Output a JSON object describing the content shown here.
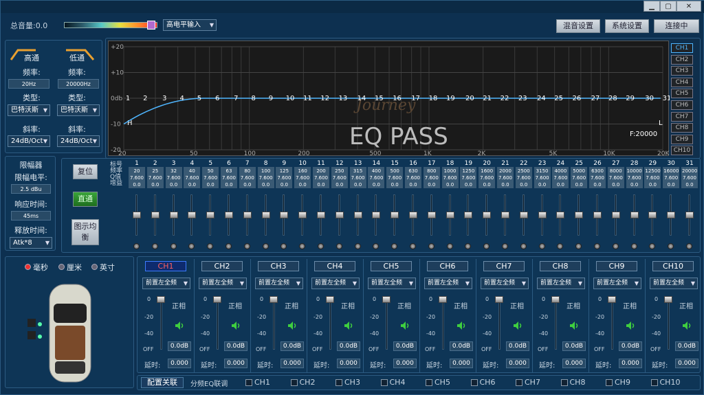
{
  "window": {
    "min": "▁",
    "max": "▢",
    "close": "✕"
  },
  "top": {
    "total_volume_label": "总音量:0.0",
    "input_select": "高电平输入",
    "mix_btn": "混音设置",
    "sys_btn": "系统设置",
    "connect_btn": "连接中"
  },
  "xover": {
    "hp_title": "高通",
    "lp_title": "低通",
    "freq_label": "频率:",
    "hp_freq": "20Hz",
    "lp_freq": "20000Hz",
    "type_label": "类型:",
    "hp_type": "巴特沃斯",
    "lp_type": "巴特沃斯",
    "slope_label": "斜率:",
    "hp_slope": "24dB/Oct",
    "lp_slope": "24dB/Oct"
  },
  "limiter": {
    "title": "限幅器",
    "level_label": "限幅电平:",
    "level": "2.5 dBu",
    "attack_label": "响应时间:",
    "attack": "45ms",
    "release_label": "释放时间:",
    "release": "Atk*8"
  },
  "graph": {
    "y_ticks": [
      "+20",
      "+10",
      "0db",
      "-10",
      "-20"
    ],
    "x_ticks": [
      "20",
      "50",
      "100",
      "200",
      "500",
      "1K",
      "2K",
      "5K",
      "10K",
      "20K"
    ],
    "hp_marker": "H",
    "lp_marker": "L",
    "mode_text": "EQ PASS",
    "freq_readout": "F:20000",
    "logo_text": "Journey",
    "band_numbers": [
      "1",
      "2",
      "3",
      "4",
      "5",
      "6",
      "7",
      "8",
      "9",
      "10",
      "11",
      "12",
      "13",
      "14",
      "15",
      "16",
      "17",
      "18",
      "19",
      "20",
      "21",
      "22",
      "23",
      "24",
      "25",
      "26",
      "27",
      "28",
      "29",
      "30",
      "31"
    ]
  },
  "channels_side": [
    "CH1",
    "CH2",
    "CH3",
    "CH4",
    "CH5",
    "CH6",
    "CH7",
    "CH8",
    "CH9",
    "CH10"
  ],
  "eq": {
    "row_labels": [
      "标号",
      "频率",
      "Q值",
      "增益"
    ],
    "reset_btn": "复位",
    "bypass_btn": "直通",
    "graph_eq_btn": "图示均衡",
    "freqs": [
      "20",
      "25",
      "32",
      "40",
      "50",
      "63",
      "80",
      "100",
      "125",
      "160",
      "200",
      "250",
      "315",
      "400",
      "500",
      "630",
      "800",
      "1000",
      "1250",
      "1600",
      "2000",
      "2500",
      "3150",
      "4000",
      "5000",
      "6300",
      "8000",
      "10000",
      "12500",
      "16000",
      "20000"
    ],
    "q": "7.600",
    "gain": "0.0"
  },
  "units": {
    "ms": "毫秒",
    "cm": "厘米",
    "inch": "英寸"
  },
  "outputs": [
    {
      "name": "CH1",
      "route": "前置左全频",
      "phase": "正相",
      "gain": "0.0dB",
      "delay_label": "延时:",
      "delay": "0.000"
    },
    {
      "name": "CH2",
      "route": "前置左全频",
      "phase": "正相",
      "gain": "0.0dB",
      "delay_label": "延时:",
      "delay": "0.000"
    },
    {
      "name": "CH3",
      "route": "前置左全频",
      "phase": "正相",
      "gain": "0.0dB",
      "delay_label": "延时:",
      "delay": "0.000"
    },
    {
      "name": "CH4",
      "route": "前置左全频",
      "phase": "正相",
      "gain": "0.0dB",
      "delay_label": "延时:",
      "delay": "0.000"
    },
    {
      "name": "CH5",
      "route": "前置左全频",
      "phase": "正相",
      "gain": "0.0dB",
      "delay_label": "延时:",
      "delay": "0.000"
    },
    {
      "name": "CH6",
      "route": "前置左全频",
      "phase": "正相",
      "gain": "0.0dB",
      "delay_label": "延时:",
      "delay": "0.000"
    },
    {
      "name": "CH7",
      "route": "前置左全频",
      "phase": "正相",
      "gain": "0.0dB",
      "delay_label": "延时:",
      "delay": "0.000"
    },
    {
      "name": "CH8",
      "route": "前置左全频",
      "phase": "正相",
      "gain": "0.0dB",
      "delay_label": "延时:",
      "delay": "0.000"
    },
    {
      "name": "CH9",
      "route": "前置左全频",
      "phase": "正相",
      "gain": "0.0dB",
      "delay_label": "延时:",
      "delay": "0.000"
    },
    {
      "name": "CH10",
      "route": "前置左全频",
      "phase": "正相",
      "gain": "0.0dB",
      "delay_label": "延时:",
      "delay": "0.000"
    }
  ],
  "fader_scale": [
    "0",
    "-20",
    "-40",
    "OFF"
  ],
  "bottom": {
    "config_btn": "配置关联",
    "link_label": "分频EQ联调",
    "chs": [
      "CH1",
      "CH2",
      "CH3",
      "CH4",
      "CH5",
      "CH6",
      "CH7",
      "CH8",
      "CH9",
      "CH10"
    ]
  }
}
